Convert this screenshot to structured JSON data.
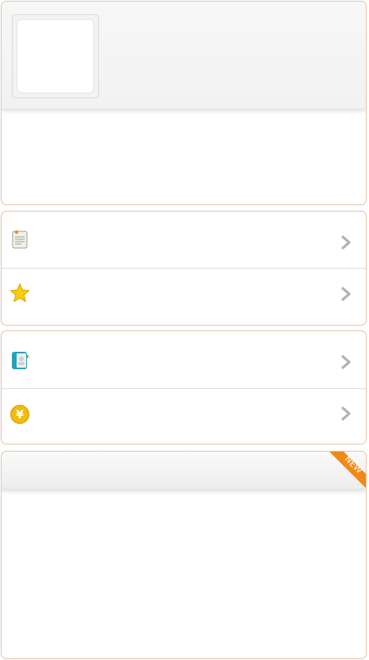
{
  "profile": {
    "avatar_icon": "avatar-placeholder"
  },
  "menu_group_1": {
    "items": [
      {
        "label": "",
        "icon": "document-icon"
      },
      {
        "label": "",
        "icon": "star-icon"
      }
    ]
  },
  "menu_group_2": {
    "items": [
      {
        "label": "",
        "icon": "contacts-book-icon"
      },
      {
        "label": "",
        "icon": "yen-coin-icon"
      }
    ]
  },
  "news": {
    "title": "",
    "badge": "NEW",
    "badge_color": "#f08a16"
  },
  "colors": {
    "card_border": "#e2c4a4",
    "chevron": "#b3b3b3",
    "star": "#f7cd05",
    "coin": "#f2b90e",
    "book": "#25a3b7"
  }
}
